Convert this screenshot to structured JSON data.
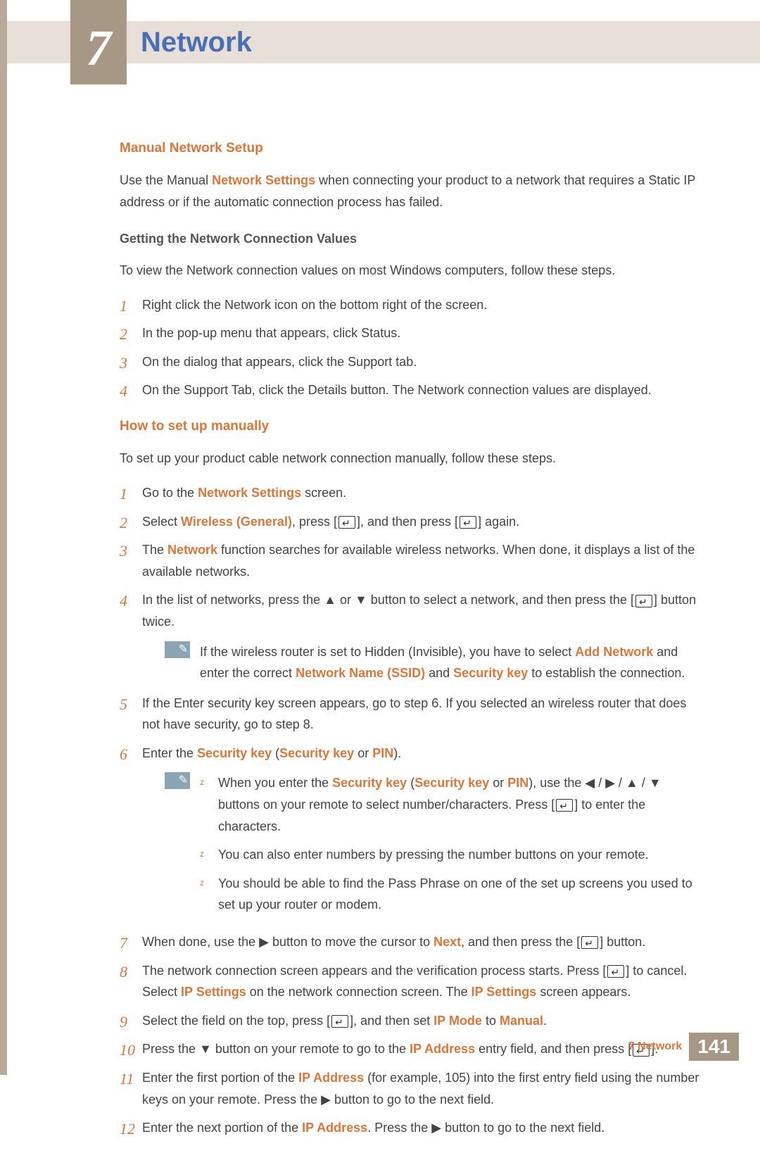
{
  "chapter": {
    "number": "7",
    "title": "Network"
  },
  "section1": {
    "heading": "Manual Network Setup",
    "intro_pre": "Use the Manual ",
    "intro_hl": "Network Settings",
    "intro_post": " when connecting your product to a network that requires a Static IP address or if the automatic connection process has failed.",
    "sub": "Getting the Network Connection Values",
    "subintro": "To view the Network connection values on most Windows computers, follow these steps.",
    "steps": [
      "Right click the Network icon on the bottom right of the screen.",
      "In the pop-up menu that appears, click Status.",
      "On the dialog that appears, click the Support tab.",
      "On the Support Tab, click the Details button. The Network connection values are displayed."
    ]
  },
  "section2": {
    "heading": "How to set up manually",
    "intro": "To set up your product cable network connection manually, follow these steps.",
    "s1_pre": "Go to the ",
    "s1_hl": "Network Settings",
    "s1_post": " screen.",
    "s2_pre": "Select ",
    "s2_hl": "Wireless (General)",
    "s2_mid": ", press [",
    "s2_mid2": "], and then press [",
    "s2_post": "] again.",
    "s3_pre": "The ",
    "s3_hl": "Network",
    "s3_post": " function searches for available wireless networks. When done, it displays a list of the available networks.",
    "s4_pre": "In the list of networks, press the ",
    "s4_up": "▲",
    "s4_or": " or ",
    "s4_down": "▼",
    "s4_mid": " button to select a network, and then press the [",
    "s4_post": "] button twice.",
    "note1_pre": "If the wireless router is set to Hidden (Invisible), you have to select ",
    "note1_hl1": "Add Network",
    "note1_mid": " and enter the correct ",
    "note1_hl2": "Network Name (SSID)",
    "note1_and": " and ",
    "note1_hl3": "Security key",
    "note1_post": " to establish the connection.",
    "s5": "If the Enter security key screen appears, go to step 6. If you selected an wireless router that does not have security, go to step 8.",
    "s6_pre": "Enter the ",
    "s6_hl1": "Security key",
    "s6_paren_open": " (",
    "s6_hl2": "Security key",
    "s6_or": " or ",
    "s6_hl3": "PIN",
    "s6_paren_close": ").",
    "note2_b1_pre": "When you enter the ",
    "note2_b1_hl1": "Security key",
    "note2_b1_po": " (",
    "note2_b1_hl2": "Security key",
    "note2_b1_or": " or ",
    "note2_b1_hl3": "PIN",
    "note2_b1_pc": "), use the ",
    "note2_b1_arrows": "◀ / ▶ / ▲ / ▼",
    "note2_b1_mid": " buttons on your remote to select number/characters. Press [",
    "note2_b1_post": "] to enter the characters.",
    "note2_b2": "You can also enter numbers by pressing the number buttons on your remote.",
    "note2_b3": "You should be able to find the Pass Phrase on one of the set up screens you used to set up your router or modem.",
    "s7_pre": "When done, use the ",
    "s7_right": "▶",
    "s7_mid": " button to move the cursor to ",
    "s7_hl": "Next",
    "s7_mid2": ", and then press the [",
    "s7_post": "] button.",
    "s8_pre": "The network connection screen appears and the verification process starts. Press [",
    "s8_mid": "] to cancel. Select ",
    "s8_hl1": "IP Settings",
    "s8_mid2": " on the network connection screen. The ",
    "s8_hl2": "IP Settings",
    "s8_post": " screen appears.",
    "s9_pre": "Select the field on the top, press [",
    "s9_mid": "], and then set ",
    "s9_hl1": "IP Mode",
    "s9_to": " to ",
    "s9_hl2": "Manual",
    "s9_post": ".",
    "s10_pre": "Press the ",
    "s10_down": "▼",
    "s10_mid": " button on your remote to go to the ",
    "s10_hl": "IP Address",
    "s10_mid2": " entry field, and then press [",
    "s10_post": "].",
    "s11_pre": "Enter the first portion of the ",
    "s11_hl": "IP Address",
    "s11_mid": " (for example, 105) into the first entry field using the number keys on your remote. Press the ",
    "s11_right": "▶",
    "s11_post": " button to go to the next field.",
    "s12_pre": "Enter the next portion of the ",
    "s12_hl": "IP Address",
    "s12_mid": ". Press the ",
    "s12_right": "▶",
    "s12_post": " button to go to the next field."
  },
  "footer": {
    "label": "7 Network",
    "page": "141"
  }
}
